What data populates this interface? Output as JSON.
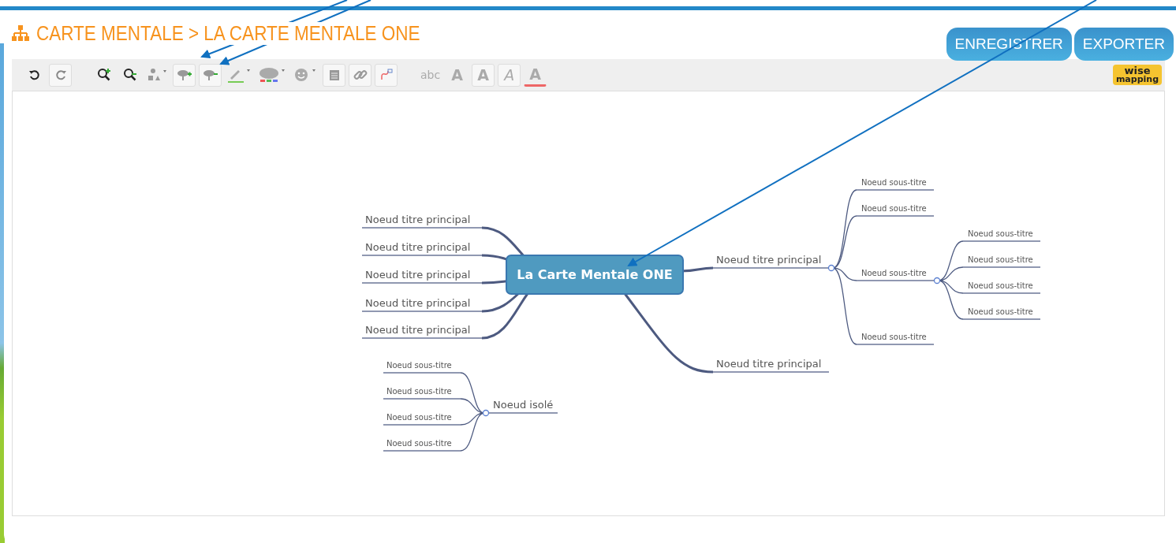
{
  "header": {
    "breadcrumb": "CARTE MENTALE > LA CARTE MENTALE ONE"
  },
  "buttons": [
    {
      "label": "ENREGISTRER"
    },
    {
      "label": "EXPORTER"
    }
  ],
  "toolbar": {
    "font_family": "abc",
    "font_size": "A",
    "bold": "A",
    "italic": "A",
    "font_color": "A"
  },
  "logo": {
    "line1": "wise",
    "line2": "mapping"
  },
  "mind_map": {
    "central_topic": {
      "text": "La Carte Mentale ONE",
      "children": [
        {
          "text": "Noeud titre principal"
        },
        {
          "text": "Noeud titre principal"
        },
        {
          "text": "Noeud titre principal"
        },
        {
          "text": "Noeud titre principal"
        },
        {
          "text": "Noeud titre principal"
        },
        {
          "text": "Noeud titre principal",
          "children": [
            {
              "text": "Noeud sous-titre"
            },
            {
              "text": "Noeud sous-titre"
            },
            {
              "text": "Noeud sous-titre",
              "children": [
                {
                  "text": "Noeud sous-titre"
                },
                {
                  "text": "Noeud sous-titre"
                },
                {
                  "text": "Noeud sous-titre"
                },
                {
                  "text": "Noeud sous-titre"
                }
              ]
            },
            {
              "text": "Noeud sous-titre"
            }
          ]
        },
        {
          "text": "Noeud titre principal"
        }
      ]
    },
    "isolated_topic": {
      "text": "Noeud isolé",
      "children": [
        {
          "text": "Noeud sous-titre"
        },
        {
          "text": "Noeud sous-titre"
        },
        {
          "text": "Noeud sous-titre"
        },
        {
          "text": "Noeud sous-titre"
        }
      ]
    }
  }
}
